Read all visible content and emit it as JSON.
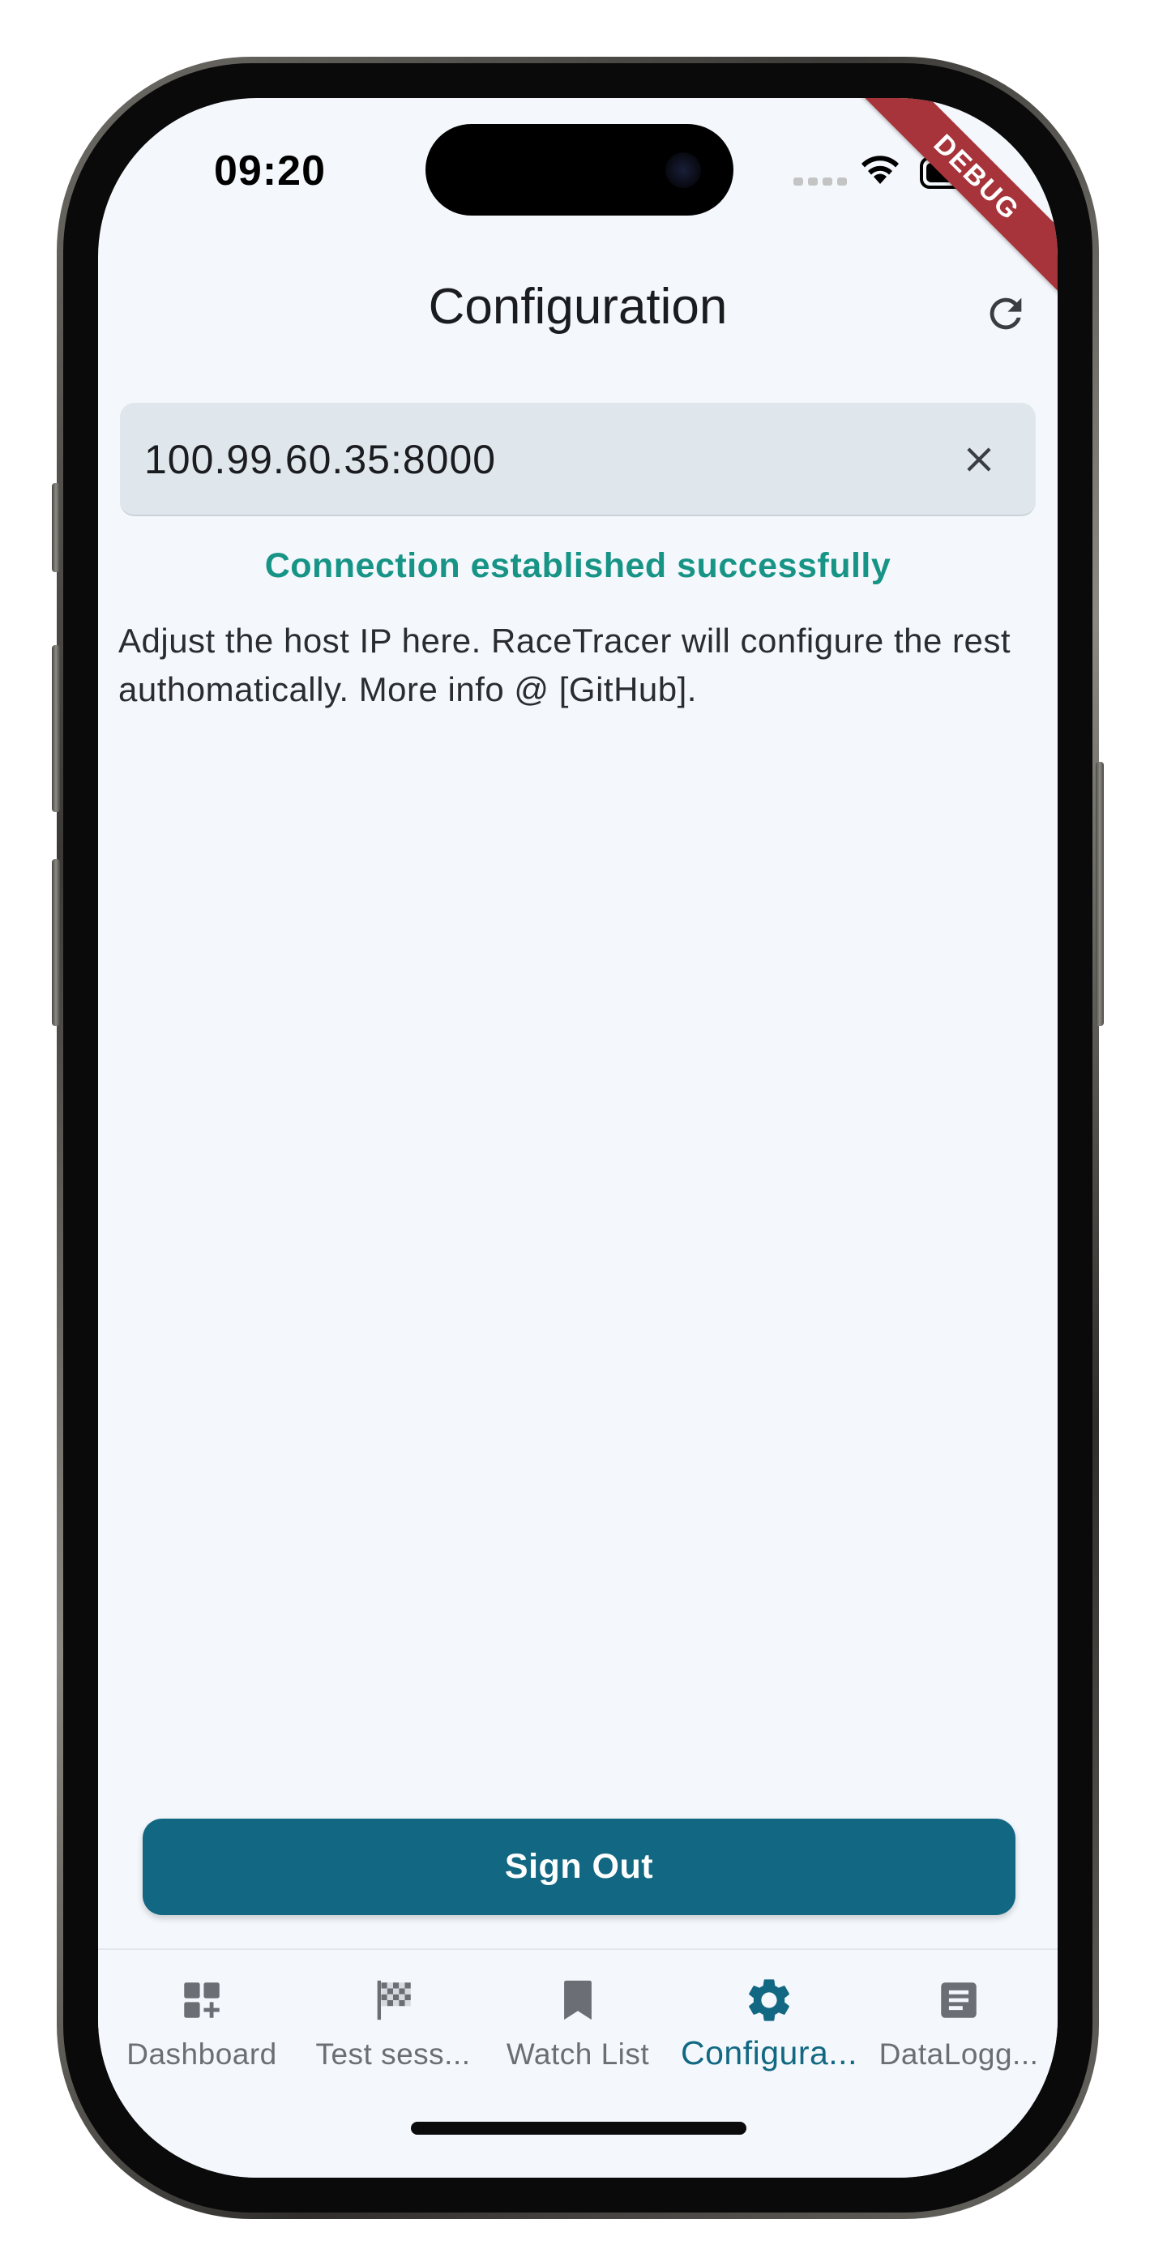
{
  "status_bar": {
    "time": "09:20"
  },
  "debug_banner": "DEBUG",
  "app_bar": {
    "title": "Configuration",
    "refresh_icon": "refresh-icon"
  },
  "host_field": {
    "value": "100.99.60.35:8000",
    "clear_icon": "close-icon"
  },
  "status_message": "Connection established successfully",
  "help_text": "Adjust the host IP here. RaceTracer will configure the rest authomatically. More info @ [GitHub].",
  "sign_out_label": "Sign Out",
  "bottom_nav": {
    "items": [
      {
        "label": "Dashboard",
        "icon": "dashboard-add-icon"
      },
      {
        "label": "Test sess...",
        "icon": "checkered-flag-icon"
      },
      {
        "label": "Watch List",
        "icon": "bookmark-icon"
      },
      {
        "label": "Configura...",
        "icon": "gear-icon"
      },
      {
        "label": "DataLogg...",
        "icon": "document-icon"
      }
    ],
    "active_index": 3
  },
  "colors": {
    "accent": "#126882",
    "success": "#179486",
    "background": "#f4f8fc",
    "field_background": "#dfe6ec",
    "debug_ribbon": "#a6343a",
    "nav_inactive": "#6b6f75"
  }
}
